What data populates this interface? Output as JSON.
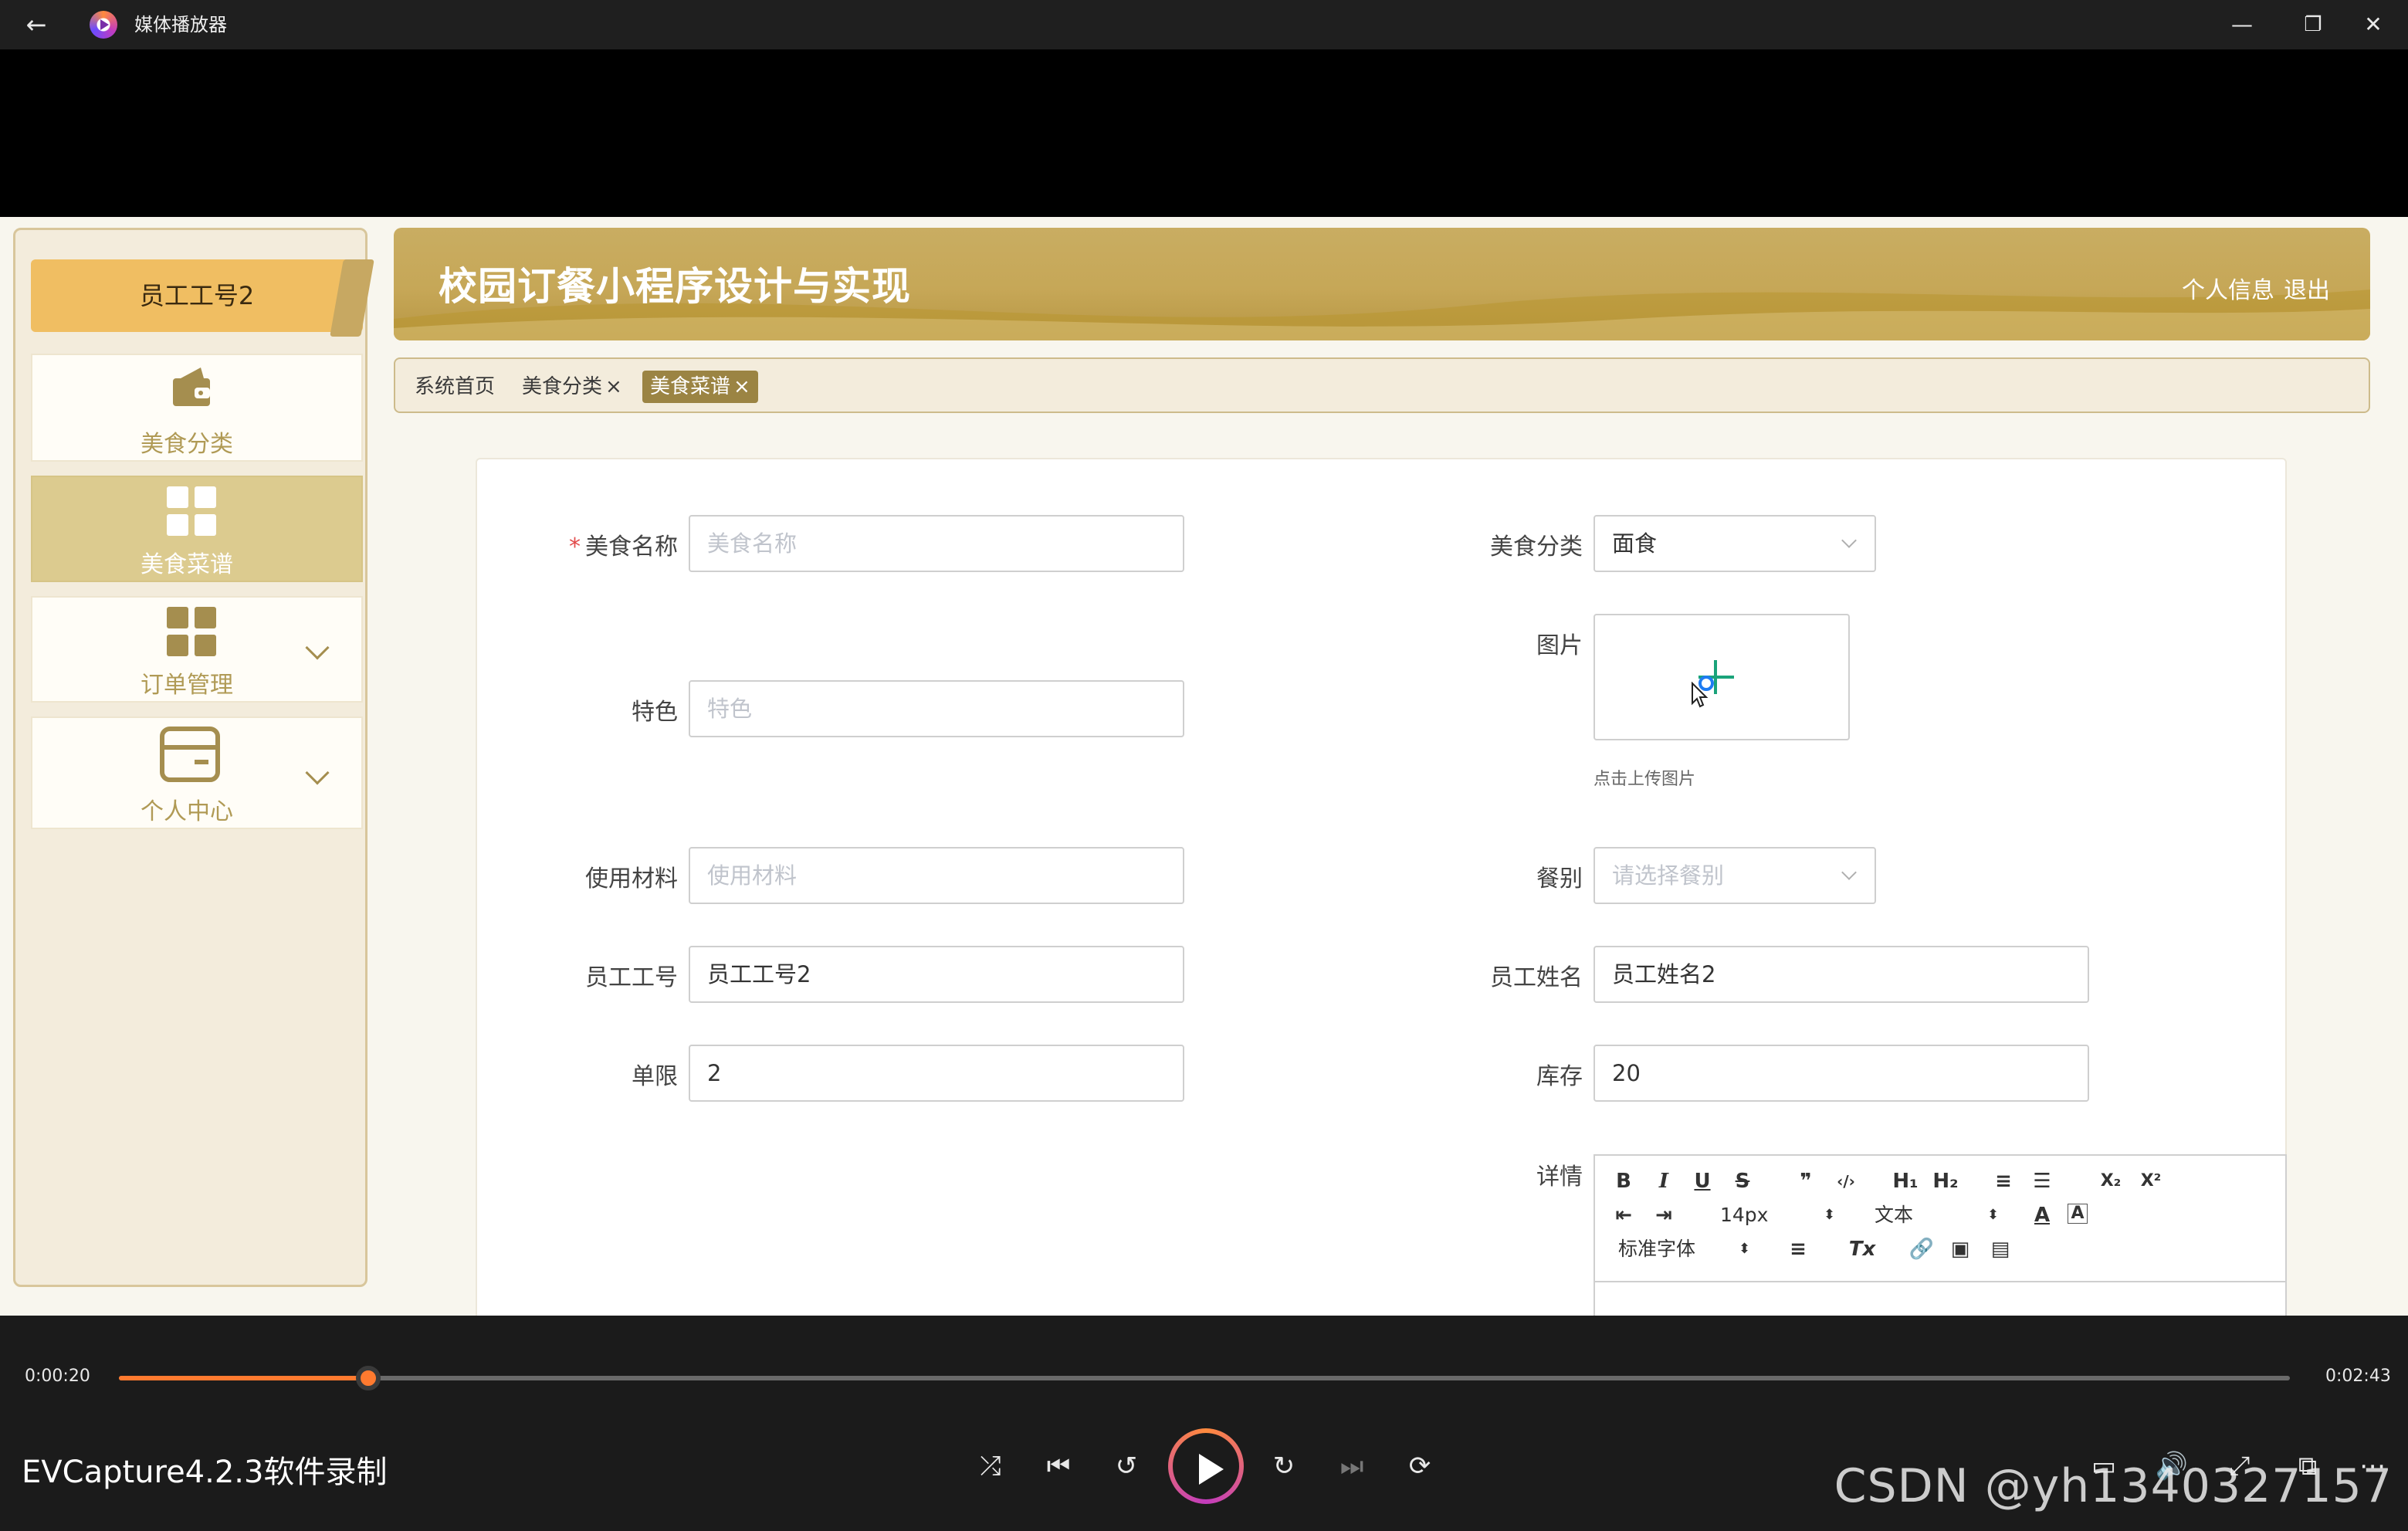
{
  "window": {
    "title": "媒体播放器",
    "back_icon": "arrow-left-icon",
    "controls": [
      "minimize-icon",
      "restore-icon",
      "close-icon"
    ]
  },
  "app": {
    "title": "校园订餐小程序设计与实现",
    "header_links": {
      "profile": "个人信息",
      "logout": "退出"
    },
    "sidebar": {
      "user_label": "员工工号2",
      "items": [
        {
          "label": "美食分类",
          "icon": "wallet-icon"
        },
        {
          "label": "美食菜谱",
          "icon": "grid-icon"
        },
        {
          "label": "订单管理",
          "icon": "grid-icon"
        },
        {
          "label": "个人中心",
          "icon": "card-icon"
        }
      ]
    },
    "tabs": [
      {
        "label": "系统首页",
        "close": ""
      },
      {
        "label": "美食分类",
        "close": "×"
      },
      {
        "label": "美食菜谱",
        "close": "×"
      }
    ],
    "colors": {
      "accent": "#c6a757",
      "active_tab": "#9b8443",
      "sidebar_user": "#f0be62"
    },
    "form": {
      "name": {
        "label": "美食名称",
        "required": "*",
        "value": "",
        "placeholder": "美食名称"
      },
      "category": {
        "label": "美食分类",
        "value": "面食"
      },
      "image": {
        "label": "图片",
        "hint": "点击上传图片"
      },
      "feature": {
        "label": "特色",
        "value": "",
        "placeholder": "特色"
      },
      "materials": {
        "label": "使用材料",
        "value": "",
        "placeholder": "使用材料"
      },
      "meal_type": {
        "label": "餐别",
        "value": "",
        "placeholder": "请选择餐别"
      },
      "emp_no": {
        "label": "员工工号",
        "value": "员工工号2"
      },
      "emp_name": {
        "label": "员工姓名",
        "value": "员工姓名2"
      },
      "limit": {
        "label": "单限",
        "value": "2"
      },
      "stock": {
        "label": "库存",
        "value": "20"
      },
      "detail": {
        "label": "详情",
        "toolbar": {
          "bold": "B",
          "italic": "I",
          "underline": "U",
          "strike": "S",
          "quote": "❞",
          "code": "‹/›",
          "h1": "H₁",
          "h2": "H₂",
          "ol": "≡",
          "ul": "☰",
          "sub": "X₂",
          "sup": "X²",
          "font_size": "14px",
          "text_type": "文本",
          "font_family": "标准字体",
          "align": "≡",
          "clear": "Tx"
        }
      }
    }
  },
  "player": {
    "current_time": "0:00:20",
    "total_time": "0:02:43",
    "progress": 0.115,
    "recorder_label": "EVCapture4.2.3软件录制",
    "watermark": "CSDN @yh1340327157"
  }
}
